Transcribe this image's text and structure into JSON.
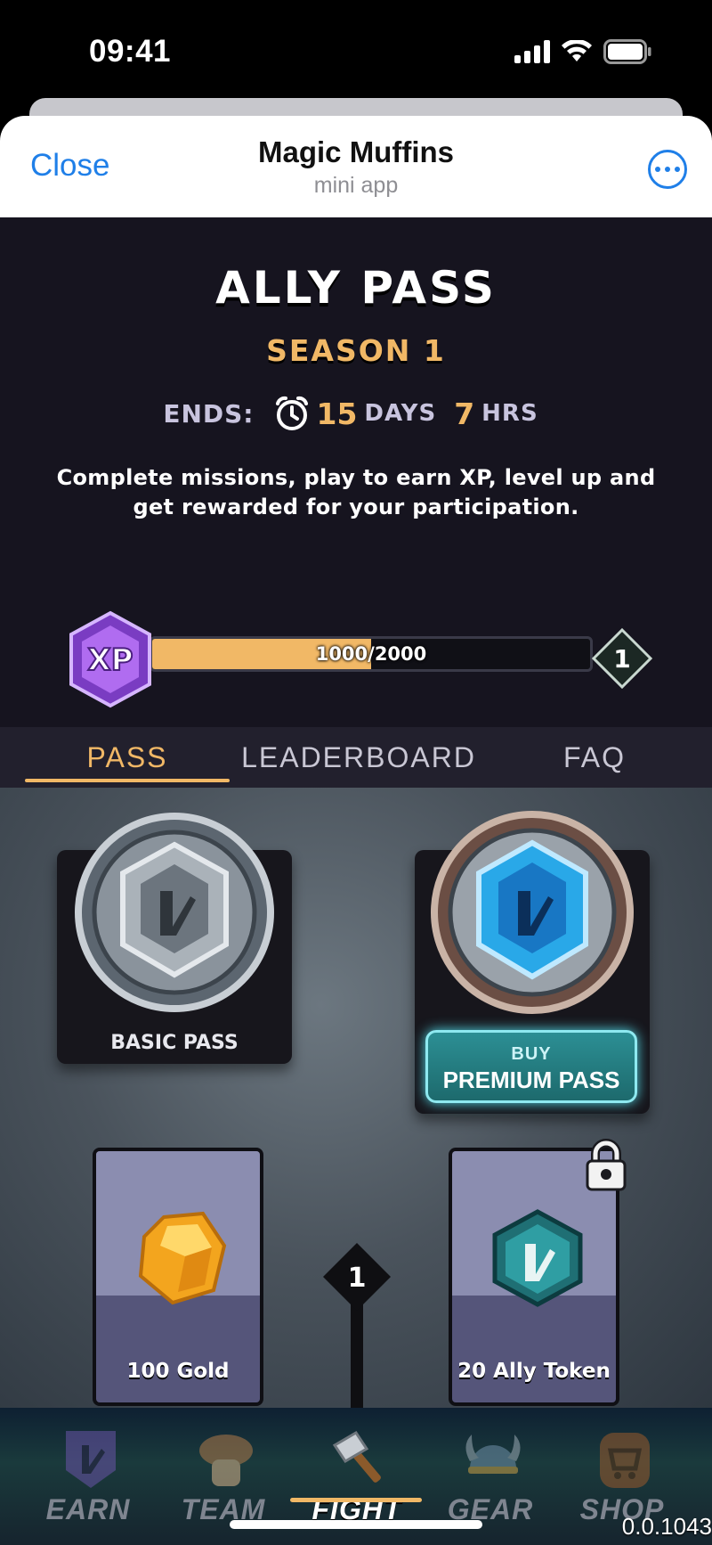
{
  "status_bar": {
    "time": "09:41"
  },
  "app_header": {
    "close_label": "Close",
    "title": "Magic Muffins",
    "subtitle": "mini app"
  },
  "hero": {
    "title": "ALLY PASS",
    "season": "SEASON 1",
    "ends_label": "ENDS:",
    "days_value": "15",
    "days_unit": "DAYS",
    "hours_value": "7",
    "hours_unit": "HRS",
    "description": "Complete missions, play to earn XP, level up and get rewarded for your participation."
  },
  "xp": {
    "badge_label": "XP",
    "progress_text": "1000/2000",
    "progress_fraction": 0.5,
    "level": "1"
  },
  "tabs": [
    {
      "label": "PASS",
      "active": true
    },
    {
      "label": "LEADERBOARD",
      "active": false
    },
    {
      "label": "FAQ",
      "active": false
    }
  ],
  "passes": {
    "basic_label": "BASIC PASS",
    "premium_buy_small": "BUY",
    "premium_buy_big": "PREMIUM PASS"
  },
  "rewards": {
    "track_level": "1",
    "basic_reward": "100 Gold",
    "premium_reward": "20 Ally Token"
  },
  "bottom_nav": [
    {
      "label": "EARN",
      "icon": "earn-icon",
      "active": false
    },
    {
      "label": "TEAM",
      "icon": "team-icon",
      "active": false
    },
    {
      "label": "FIGHT",
      "icon": "fight-icon",
      "active": true
    },
    {
      "label": "GEAR",
      "icon": "gear-icon",
      "active": false
    },
    {
      "label": "SHOP",
      "icon": "shop-icon",
      "active": false
    }
  ],
  "version": "0.0.1043",
  "colors": {
    "accent": "#f1b866",
    "ios_blue": "#1f7fe8",
    "background_dark": "#16141f",
    "premium_teal": "#2c8f94"
  }
}
